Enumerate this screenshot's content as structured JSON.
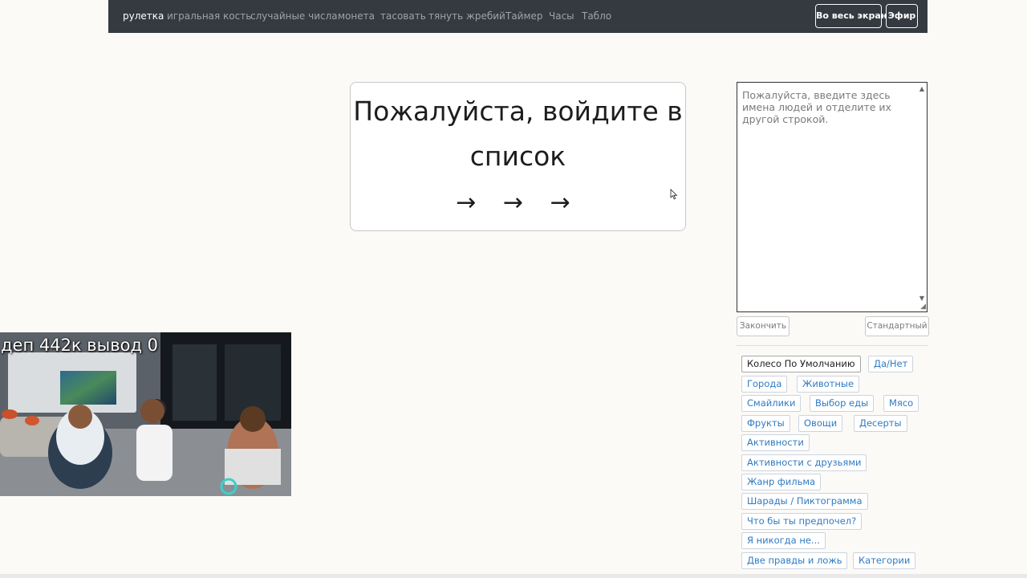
{
  "nav": {
    "links": [
      "рулетка",
      "игральная кость",
      "случайные числа",
      "монета",
      "тасовать",
      "тянуть жребий",
      "Таймер",
      "Часы",
      "Табло"
    ],
    "fullscreen_label": "Во весь экран",
    "broadcast_label": "Эфир"
  },
  "wheel": {
    "message_line1": "Пожалуйста, войдите в",
    "message_line2": "список",
    "arrows": "→ → →"
  },
  "names": {
    "placeholder": "Пожалуйста, введите здесь имена людей и отделите их другой строкой."
  },
  "actions": {
    "finish_label": "Закончить",
    "standard_label": "Стандартный"
  },
  "presets": [
    "Колесо По Умолчанию",
    "Да/Нет",
    "Города",
    "Животные",
    "Смайлики",
    "Выбор еды",
    "Мясо",
    "Фрукты",
    "Овощи",
    "Десерты",
    "Активности",
    "Активности с друзьями",
    "Жанр фильма",
    "Шарады / Пиктограмма",
    "Что бы ты предпочел?",
    "Я никогда не...",
    "Две правды и ложь",
    "Категории"
  ],
  "webcam": {
    "caption": "деп 442к вывод 0"
  },
  "colors": {
    "navbar_bg": "#343a40",
    "link_blue": "#2f7bc1",
    "page_bg": "#fcfaf7"
  }
}
